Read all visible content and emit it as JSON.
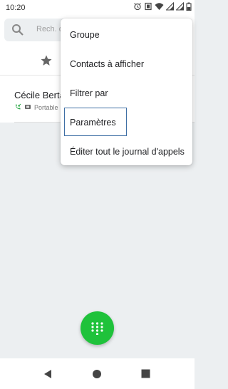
{
  "status_bar": {
    "time": "10:20",
    "icons": [
      "alarm-icon",
      "vibrate-icon",
      "wifi-icon",
      "signal-icon",
      "signal-icon",
      "battery-icon"
    ]
  },
  "search": {
    "placeholder": "Rech. de"
  },
  "tabs": {
    "favorites_icon": "star-icon"
  },
  "contact": {
    "name": "Cécile Berta",
    "type": "Portable",
    "call_icon": "call-received-icon",
    "sim_icon": "sim-icon"
  },
  "menu": {
    "items": [
      {
        "label": "Groupe"
      },
      {
        "label": "Contacts à afficher"
      },
      {
        "label": "Filtrer par"
      },
      {
        "label": "Paramètres"
      },
      {
        "label": "Éditer tout le journal d'appels"
      }
    ],
    "selected_index": 3
  },
  "fab": {
    "icon": "dialpad-icon",
    "color": "#1fc23b"
  },
  "nav": {
    "icons": [
      "back-icon",
      "home-icon",
      "recents-icon"
    ]
  },
  "colors": {
    "highlight_border": "#3f6fa5",
    "background": "#eceff1"
  }
}
